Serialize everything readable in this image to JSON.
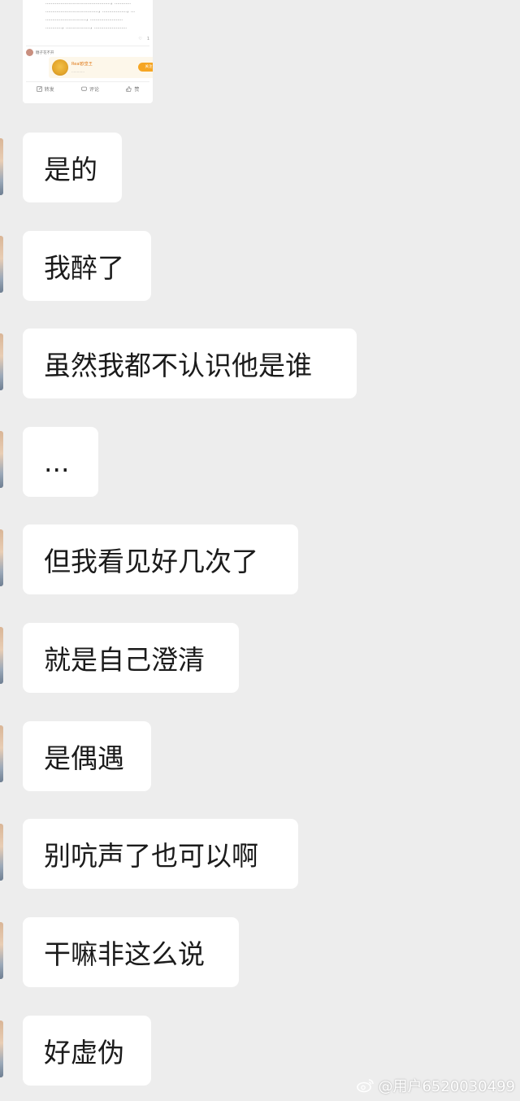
{
  "shared_post": {
    "text_lines": [
      "…………………………………………，…………",
      "…………………………………，………………，…",
      "…………………………，……………………",
      "…………，………………，……………………"
    ],
    "comment_user": "糖子花不开",
    "promo": {
      "title": "Real欧皇王",
      "button": "关注"
    },
    "actions": {
      "repost": "转发",
      "comment": "评论",
      "like": "赞"
    },
    "like_count": "1"
  },
  "messages": [
    {
      "text": "是的"
    },
    {
      "text": "我醉了"
    },
    {
      "text": "虽然我都不认识他是谁"
    },
    {
      "text": "..."
    },
    {
      "text": "但我看见好几次了"
    },
    {
      "text": "就是自己澄清"
    },
    {
      "text": "是偶遇"
    },
    {
      "text": "别吭声了也可以啊"
    },
    {
      "text": "干嘛非这么说"
    },
    {
      "text": "好虚伪"
    }
  ],
  "watermark": {
    "text": "@用户6520030499",
    "icon": "weibo-logo-icon"
  },
  "colors": {
    "background": "#ededed",
    "bubble": "#ffffff",
    "text": "#1b1b1b",
    "promo_accent": "#f6a623"
  }
}
